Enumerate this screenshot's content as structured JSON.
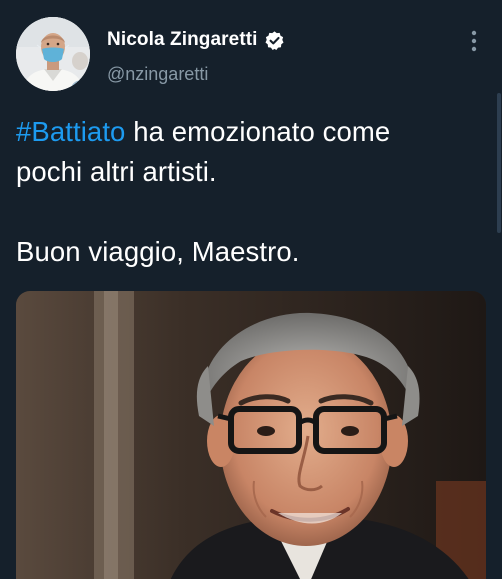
{
  "tweet": {
    "author": {
      "display_name": "Nicola Zingaretti",
      "handle": "@nzingaretti",
      "verified": true,
      "avatar_icon": "profile-photo"
    },
    "text": {
      "hashtag": "#Battiato",
      "line1_rest": " ha emozionato come",
      "line2": "pochi altri artisti.",
      "line3": "Buon viaggio, Maestro."
    },
    "media": {
      "type": "photo"
    },
    "more_icon": "more-vertical-icon"
  },
  "colors": {
    "background": "#15202b",
    "text": "#ffffff",
    "secondary_text": "#8899a6",
    "link": "#1d9bf0"
  }
}
